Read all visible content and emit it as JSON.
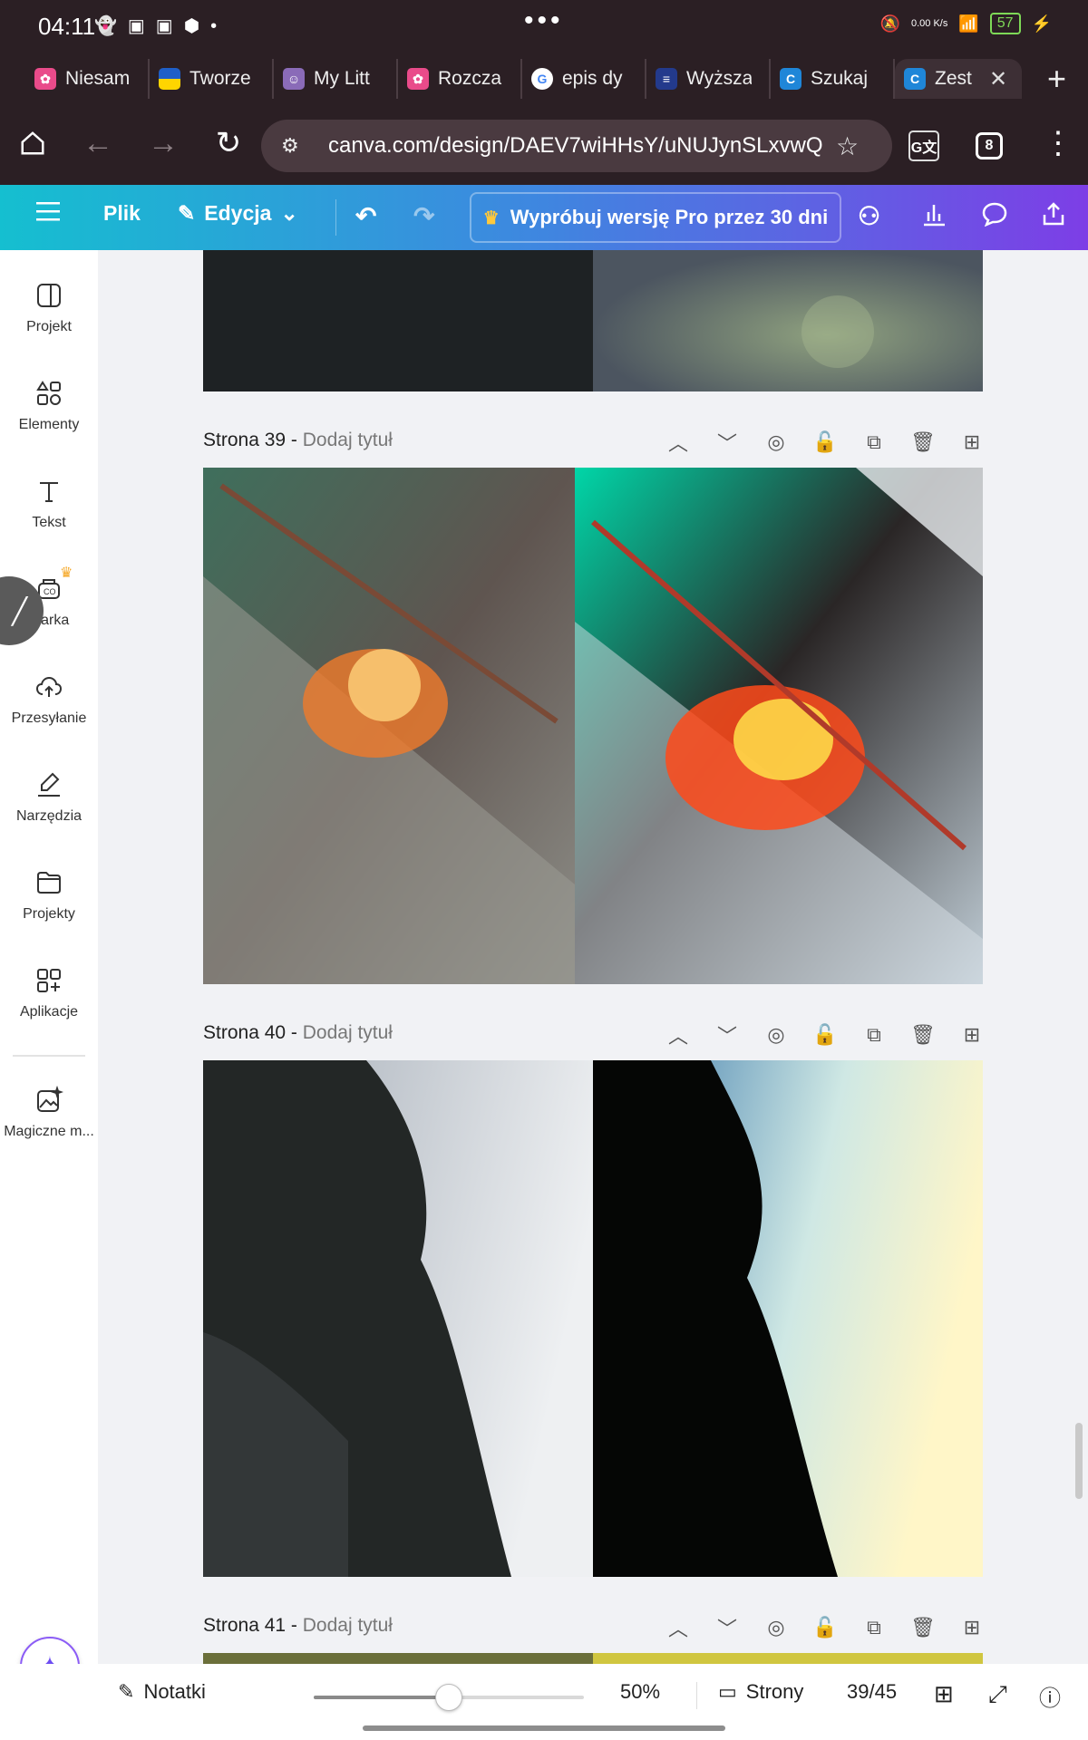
{
  "status": {
    "time": "04:11",
    "net_speed": "0.00 K/s",
    "battery": "57"
  },
  "tabs": [
    {
      "label": "Niesam",
      "color": "#e94b8a",
      "icon": "canva-favicon-icon"
    },
    {
      "label": "Tworze",
      "color": "#1f5fc8",
      "icon": "ukraine-flag-icon"
    },
    {
      "label": "My Litt",
      "color": "#8a6bb8",
      "icon": "avatar-favicon-icon"
    },
    {
      "label": "Rozcza",
      "color": "#e94b8a",
      "icon": "canva-favicon-icon"
    },
    {
      "label": "epis dy",
      "color": "#ffffff",
      "icon": "google-icon"
    },
    {
      "label": "Wyższa",
      "color": "#233a8c",
      "icon": "bookmark-favicon-icon"
    },
    {
      "label": "Szukaj",
      "color": "#1f86d8",
      "icon": "canva-c-icon"
    },
    {
      "label": "Zest",
      "color": "#1f86d8",
      "icon": "canva-c-icon",
      "active": true
    }
  ],
  "address": {
    "url": "canva.com/design/DAEV7wiHHsY/uNUJynSLxvwQ",
    "tab_count": "8"
  },
  "toolbar": {
    "file": "Plik",
    "edit": "Edycja",
    "pro": "Wypróbuj wersję Pro przez 30 dni"
  },
  "sidebar": [
    {
      "label": "Projekt",
      "icon": "layout-icon"
    },
    {
      "label": "Elementy",
      "icon": "shapes-icon"
    },
    {
      "label": "Tekst",
      "icon": "text-icon"
    },
    {
      "label": "Marka",
      "icon": "brand-icon"
    },
    {
      "label": "Przesyłanie",
      "icon": "cloud-upload-icon"
    },
    {
      "label": "Narzędzia",
      "icon": "draw-icon"
    },
    {
      "label": "Projekty",
      "icon": "folder-icon"
    },
    {
      "label": "Aplikacje",
      "icon": "apps-icon"
    },
    {
      "label": "Magiczne m...",
      "icon": "magic-media-icon"
    }
  ],
  "pages": [
    {
      "title": "Strona 39",
      "subtitle": "Dodaj tytuł"
    },
    {
      "title": "Strona 40",
      "subtitle": "Dodaj tytuł"
    },
    {
      "title": "Strona 41",
      "subtitle": "Dodaj tytuł"
    }
  ],
  "bottom": {
    "notes": "Notatki",
    "zoom": "50%",
    "zoom_level": 0.5,
    "pages_label": "Strony",
    "page_counter": "39/45"
  }
}
